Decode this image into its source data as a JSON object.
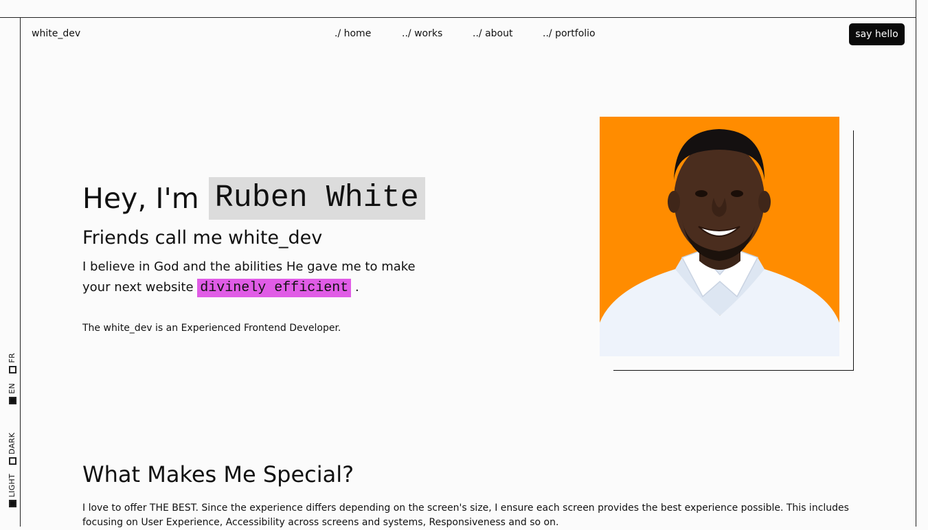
{
  "header": {
    "logo": "white_dev",
    "nav": [
      {
        "label": "./ home"
      },
      {
        "label": "../ works"
      },
      {
        "label": "../ about"
      },
      {
        "label": "../ portfolio"
      }
    ],
    "cta_label": "say hello"
  },
  "side_toggles": {
    "language": [
      {
        "label": "FR",
        "selected": false
      },
      {
        "label": "EN",
        "selected": true
      }
    ],
    "theme": [
      {
        "label": "DARK",
        "selected": false
      },
      {
        "label": "LIGHT",
        "selected": true
      }
    ]
  },
  "hero": {
    "greeting": "Hey, I'm",
    "name": "Ruben White",
    "subtitle": "Friends call me white_dev",
    "belief_text": "I believe in God and the abilities He gave me to make your next website",
    "belief_highlight": "divinely efficient",
    "belief_end": ".",
    "role": "The white_dev is an Experienced Frontend Developer.",
    "photo_bg": "#ff8c00",
    "highlight_color": "#e05ce6"
  },
  "special": {
    "title": "What Makes Me Special?",
    "body": "I love to offer THE BEST. Since the experience differs depending on the screen's size, I ensure each screen provides the best experience possible. This includes focusing on User Experience, Accessibility across screens and systems, Responsiveness and so on."
  }
}
